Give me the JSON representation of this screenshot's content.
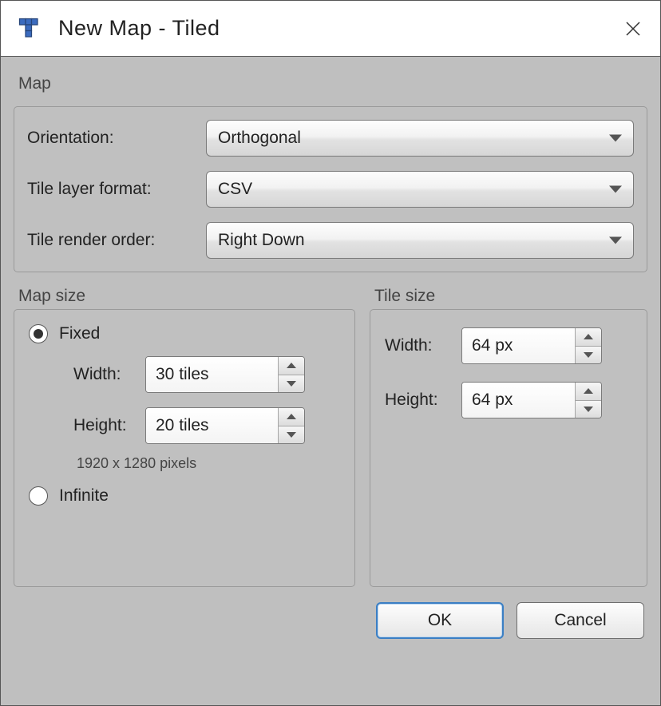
{
  "title": "New Map - Tiled",
  "groups": {
    "map": {
      "caption": "Map",
      "orientation_label": "Orientation:",
      "orientation_value": "Orthogonal",
      "tile_layer_format_label": "Tile layer format:",
      "tile_layer_format_value": "CSV",
      "tile_render_order_label": "Tile render order:",
      "tile_render_order_value": "Right Down"
    },
    "map_size": {
      "caption": "Map size",
      "fixed_label": "Fixed",
      "infinite_label": "Infinite",
      "fixed_checked": true,
      "width_label": "Width:",
      "height_label": "Height:",
      "width_value": "30 tiles",
      "height_value": "20 tiles",
      "pixel_info": "1920 x 1280 pixels"
    },
    "tile_size": {
      "caption": "Tile size",
      "width_label": "Width:",
      "height_label": "Height:",
      "width_value": "64 px",
      "height_value": "64 px"
    }
  },
  "buttons": {
    "ok": "OK",
    "cancel": "Cancel"
  }
}
